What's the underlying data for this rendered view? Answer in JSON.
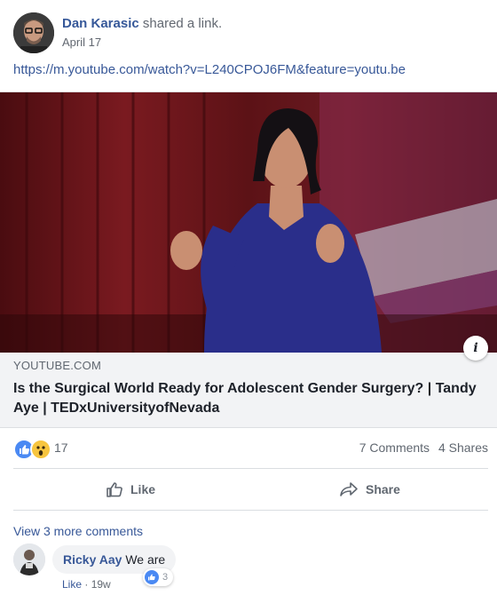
{
  "post": {
    "author": "Dan Karasic",
    "action": "shared a link.",
    "date": "April 17",
    "url": "https://m.youtube.com/watch?v=L240CPOJ6FM&feature=youtu.be"
  },
  "link_card": {
    "domain": "YOUTUBE.COM",
    "title": "Is the Surgical World Ready for Adolescent Gender Surgery? | Tandy Aye | TEDxUniversityofNevada",
    "info_icon": "i"
  },
  "stats": {
    "reaction_count": "17",
    "comments": "7 Comments",
    "shares": "4 Shares"
  },
  "actions": {
    "like_label": "Like",
    "share_label": "Share"
  },
  "comments": {
    "view_more": "View 3 more comments",
    "items": [
      {
        "name": "Ricky Aay",
        "text": "We are",
        "like_label": "Like",
        "separator": "·",
        "age": "19w",
        "reaction_count": "3"
      }
    ]
  },
  "colors": {
    "link": "#385898",
    "name": "#365899",
    "like_reaction": "#4a89f3",
    "wow_reaction": "#f7c53f"
  }
}
